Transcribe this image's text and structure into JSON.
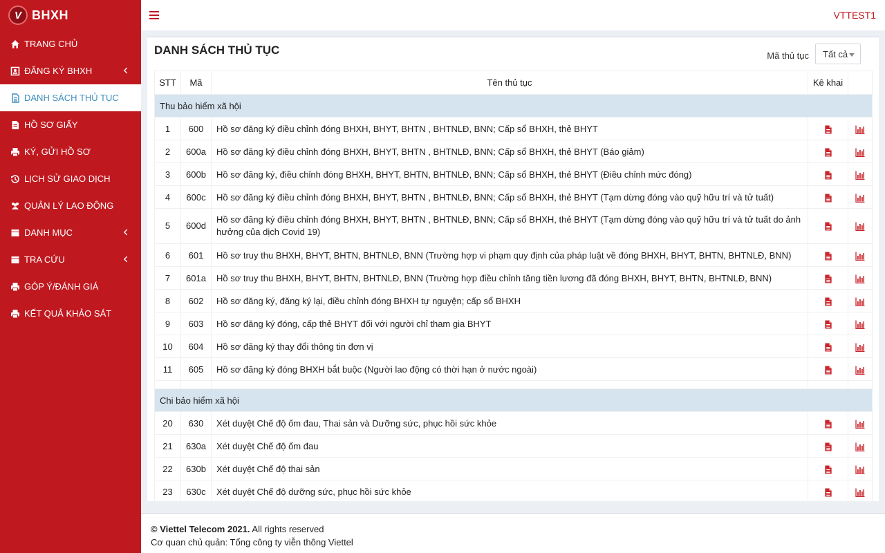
{
  "app": {
    "logo_text": "BHXH",
    "logo_letter": "V",
    "user": "VTTEST1"
  },
  "colors": {
    "brand": "#c0181f",
    "active_text": "#3c8dbc",
    "group_row": "#d6e4ef"
  },
  "sidebar": {
    "items": [
      {
        "label": "TRANG CHỦ",
        "icon": "home-icon",
        "has_chevron": false,
        "active": false
      },
      {
        "label": "ĐĂNG KÝ BHXH",
        "icon": "id-card-icon",
        "has_chevron": true,
        "active": false
      },
      {
        "label": "DANH SÁCH THỦ TỤC",
        "icon": "document-icon",
        "has_chevron": false,
        "active": true
      },
      {
        "label": "HỒ SƠ GIẤY",
        "icon": "file-text-icon",
        "has_chevron": false,
        "active": false
      },
      {
        "label": "KÝ, GỬI HỒ SƠ",
        "icon": "print-icon",
        "has_chevron": false,
        "active": false
      },
      {
        "label": "LỊCH SỬ GIAO DỊCH",
        "icon": "history-icon",
        "has_chevron": false,
        "active": false
      },
      {
        "label": "QUẢN LÝ LAO ĐỘNG",
        "icon": "users-icon",
        "has_chevron": false,
        "active": false
      },
      {
        "label": "DANH MỤC",
        "icon": "table-icon",
        "has_chevron": true,
        "active": false
      },
      {
        "label": "TRA CỨU",
        "icon": "table-icon",
        "has_chevron": true,
        "active": false
      },
      {
        "label": "GÓP Ý/ĐÁNH GIÁ",
        "icon": "print-icon",
        "has_chevron": false,
        "active": false
      },
      {
        "label": "KẾT QUẢ KHẢO SÁT",
        "icon": "print-icon",
        "has_chevron": false,
        "active": false
      }
    ]
  },
  "main": {
    "title": "DANH SÁCH THỦ TỤC",
    "filter_label": "Mã thủ tục",
    "filter_value": "Tất cả",
    "columns": {
      "stt": "STT",
      "ma": "Mã",
      "ten": "Tên thủ tục",
      "kekhai": "Kê khai",
      "extra": ""
    },
    "groups": [
      {
        "name": "Thu bảo hiểm xã hội",
        "rows": [
          {
            "stt": "1",
            "ma": "600",
            "ten": "Hồ sơ đăng ký điều chỉnh đóng BHXH, BHYT, BHTN , BHTNLĐ, BNN; Cấp sổ BHXH, thẻ BHYT"
          },
          {
            "stt": "2",
            "ma": "600a",
            "ten": "Hồ sơ đăng ký điều chỉnh đóng BHXH, BHYT, BHTN , BHTNLĐ, BNN; Cấp sổ BHXH, thẻ BHYT (Báo giảm)"
          },
          {
            "stt": "3",
            "ma": "600b",
            "ten": "Hồ sơ đăng ký, điều chỉnh đóng BHXH, BHYT, BHTN, BHTNLĐ, BNN; Cấp sổ BHXH, thẻ BHYT (Điều chỉnh mức đóng)"
          },
          {
            "stt": "4",
            "ma": "600c",
            "ten": "Hồ sơ đăng ký điều chỉnh đóng BHXH, BHYT, BHTN , BHTNLĐ, BNN; Cấp sổ BHXH, thẻ BHYT (Tạm dừng đóng vào quỹ hữu trí và tử tuất)"
          },
          {
            "stt": "5",
            "ma": "600d",
            "ten": "Hồ sơ đăng ký điều chỉnh đóng BHXH, BHYT, BHTN , BHTNLĐ, BNN; Cấp sổ BHXH, thẻ BHYT (Tạm dừng đóng vào quỹ hữu trí và tử tuất do ảnh hưởng của dịch Covid 19)",
            "tall": true
          },
          {
            "stt": "6",
            "ma": "601",
            "ten": "Hồ sơ truy thu BHXH, BHYT, BHTN, BHTNLĐ, BNN (Trường hợp vi phạm quy định của pháp luật về đóng BHXH, BHYT, BHTN, BHTNLĐ, BNN)"
          },
          {
            "stt": "7",
            "ma": "601a",
            "ten": "Hồ sơ truy thu BHXH, BHYT, BHTN, BHTNLĐ, BNN (Trường hợp điều chỉnh tăng tiền lương đã đóng BHXH, BHYT, BHTN, BHTNLĐ, BNN)"
          },
          {
            "stt": "8",
            "ma": "602",
            "ten": "Hồ sơ đăng ký, đăng ký lại, điều chỉnh đóng BHXH tự nguyện; cấp sổ BHXH"
          },
          {
            "stt": "9",
            "ma": "603",
            "ten": "Hồ sơ đăng ký đóng, cấp thẻ BHYT đối với người chỉ tham gia BHYT"
          },
          {
            "stt": "10",
            "ma": "604",
            "ten": "Hồ sơ đăng ký thay đổi thông tin đơn vị"
          },
          {
            "stt": "11",
            "ma": "605",
            "ten": "Hồ sơ đăng ký đóng BHXH bắt buộc (Người lao động có thời hạn ở nước ngoài)"
          }
        ]
      },
      {
        "name": "Chi bảo hiểm xã hội",
        "rows": [
          {
            "stt": "20",
            "ma": "630",
            "ten": "Xét duyệt Chế độ ốm đau, Thai sản và Dưỡng sức, phục hồi sức khỏe"
          },
          {
            "stt": "21",
            "ma": "630a",
            "ten": "Xét duyệt Chế độ ốm đau"
          },
          {
            "stt": "22",
            "ma": "630b",
            "ten": "Xét duyệt Chế độ thai sản"
          },
          {
            "stt": "23",
            "ma": "630c",
            "ten": "Xét duyệt Chế độ dưỡng sức, phục hồi sức khỏe"
          }
        ]
      }
    ]
  },
  "footer": {
    "copyright_bold": "© Viettel Telecom 2021.",
    "copyright_rest": " All rights reserved",
    "owner": "Cơ quan chủ quản: Tổng công ty viễn thông Viettel"
  }
}
